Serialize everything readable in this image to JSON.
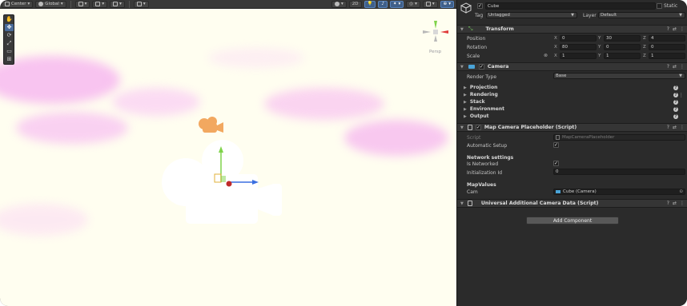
{
  "scene": {
    "toolbar": {
      "pivot_label": "Center",
      "space_label": "Global",
      "mode_2d_label": "2D"
    },
    "gizmo": {
      "view_label": "Persp"
    },
    "tools": [
      "hand",
      "move",
      "rotate",
      "scale",
      "rect",
      "transform"
    ]
  },
  "inspector": {
    "object": {
      "name": "Cube",
      "static_label": "Static",
      "tag_label": "Tag",
      "tag_value": "Untagged",
      "layer_label": "Layer",
      "layer_value": "Default"
    },
    "transform": {
      "title": "Transform",
      "position_label": "Position",
      "rotation_label": "Rotation",
      "scale_label": "Scale",
      "axis_x": "X",
      "axis_y": "Y",
      "axis_z": "Z",
      "position": {
        "x": "0",
        "y": "30",
        "z": "4"
      },
      "rotation": {
        "x": "80",
        "y": "0",
        "z": "0"
      },
      "scale": {
        "x": "1",
        "y": "1",
        "z": "1"
      }
    },
    "camera": {
      "title": "Camera",
      "render_type_label": "Render Type",
      "render_type_value": "Base",
      "sections": [
        "Projection",
        "Rendering",
        "Stack",
        "Environment",
        "Output"
      ]
    },
    "placeholder": {
      "title": "Map Camera Placeholder (Script)",
      "script_label": "Script",
      "script_value": "MapCameraPlaceholder",
      "auto_setup_label": "Automatic Setup",
      "network_header": "Network settings",
      "is_networked_label": "Is Networked",
      "init_id_label": "Initialization Id",
      "init_id_value": "0",
      "mapvalues_header": "MapValues",
      "cam_label": "Cam",
      "cam_value": "Cube (Camera)"
    },
    "urp_data": {
      "title": "Universal Additional Camera Data (Script)"
    },
    "add_component_label": "Add Component"
  },
  "colors": {
    "scene_bg": "#fffef0",
    "camera_icon": "#f2a860",
    "axis_x": "#e03a3a",
    "axis_y": "#7fd34a",
    "axis_z": "#3a6fe0",
    "accent": "#4a6b9a"
  }
}
